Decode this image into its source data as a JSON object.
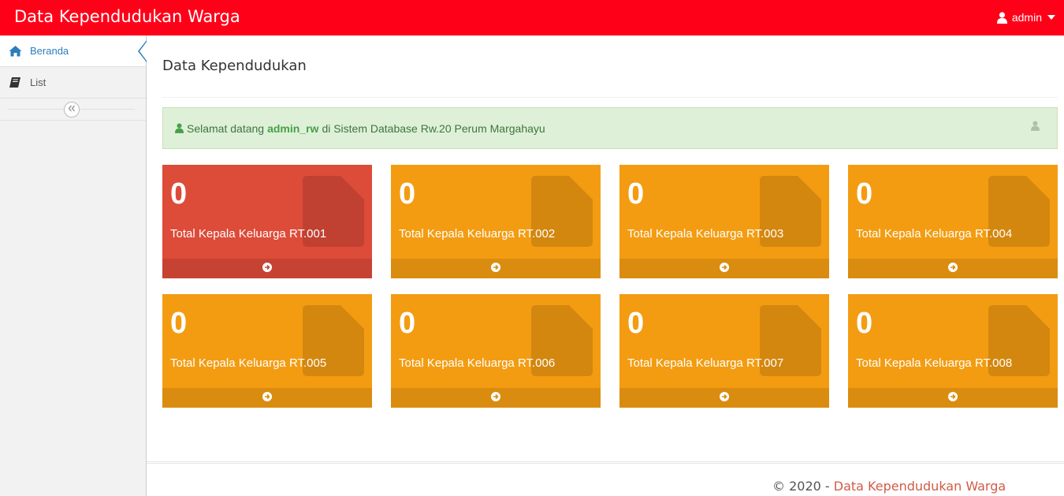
{
  "app": {
    "title": "Data Kependudukan Warga",
    "user": "admin"
  },
  "sidebar": {
    "items": [
      {
        "label": "Beranda",
        "icon": "home-icon",
        "active": true
      },
      {
        "label": "List",
        "icon": "book-icon",
        "active": false
      }
    ],
    "collapse_icon": "double-chevron-left-icon"
  },
  "page": {
    "title": "Data Kependudukan"
  },
  "alert": {
    "prefix": "Selamat datang",
    "username": "admin_rw",
    "suffix": "di Sistem Database Rw.20 Perum Margahayu"
  },
  "boxes": [
    {
      "value": "0",
      "label": "Total Kepala Keluarga RT.001",
      "color": "red"
    },
    {
      "value": "0",
      "label": "Total Kepala Keluarga RT.002",
      "color": "orange"
    },
    {
      "value": "0",
      "label": "Total Kepala Keluarga RT.003",
      "color": "orange"
    },
    {
      "value": "0",
      "label": "Total Kepala Keluarga RT.004",
      "color": "orange"
    },
    {
      "value": "0",
      "label": "Total Kepala Keluarga RT.005",
      "color": "orange"
    },
    {
      "value": "0",
      "label": "Total Kepala Keluarga RT.006",
      "color": "orange"
    },
    {
      "value": "0",
      "label": "Total Kepala Keluarga RT.007",
      "color": "orange"
    },
    {
      "value": "0",
      "label": "Total Kepala Keluarga RT.008",
      "color": "orange"
    }
  ],
  "footer": {
    "copyright": "© 2020 - ",
    "brand": "Data Kependudukan Warga"
  },
  "colors": {
    "navbar": "#ff0019",
    "red_box": "#dd4b39",
    "orange_box": "#f39c12",
    "accent_blue": "#2b7dbc",
    "alert_bg": "#dff0d8"
  }
}
